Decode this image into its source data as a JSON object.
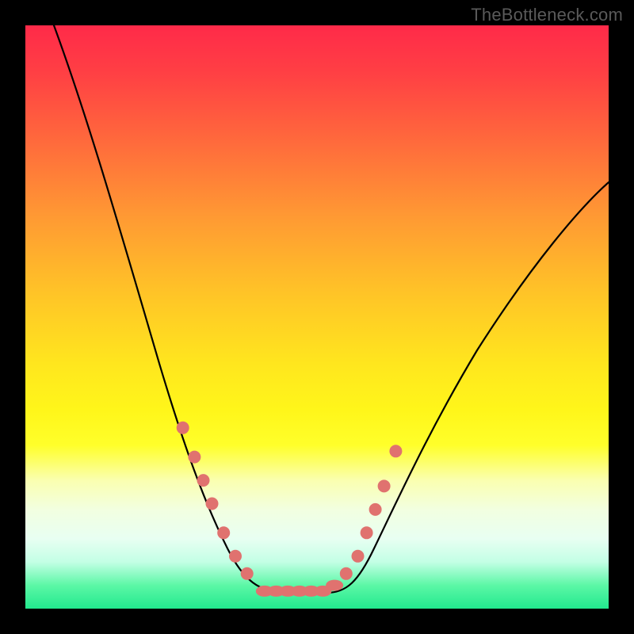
{
  "branding": {
    "watermark": "TheBottleneck.com"
  },
  "colors": {
    "frame": "#000000",
    "gradient_top": "#ff2a49",
    "gradient_bottom": "#22e98e",
    "curve_stroke": "#000000",
    "marker_fill": "#e0726f"
  },
  "chart_data": {
    "type": "line",
    "title": "",
    "xlabel": "",
    "ylabel": "",
    "xlim": [
      0,
      100
    ],
    "ylim": [
      0,
      100
    ],
    "note": "No axis ticks or numeric labels are rendered in the source image; x/y values are visual estimates on a 0–100 scale (0,0 at bottom-left of colored plot area). The curve is a V-shaped bottleneck profile with a flat minimum; marker dots sit along the curve near and at the minimum.",
    "series": [
      {
        "name": "bottleneck-curve",
        "x": [
          5,
          10,
          15,
          20,
          24,
          27,
          29,
          31,
          33,
          35,
          37,
          39,
          41,
          43,
          47,
          51,
          54,
          56,
          58,
          60,
          63,
          67,
          72,
          78,
          85,
          92,
          100
        ],
        "y": [
          100,
          85,
          68,
          52,
          40,
          31,
          25,
          20,
          16,
          12,
          9,
          6,
          4,
          3,
          3,
          3,
          4,
          6,
          9,
          13,
          19,
          27,
          36,
          44,
          51,
          57,
          62
        ]
      }
    ],
    "markers": {
      "name": "highlight-dots",
      "points": [
        {
          "x": 27,
          "y": 31
        },
        {
          "x": 29,
          "y": 26
        },
        {
          "x": 30.5,
          "y": 22
        },
        {
          "x": 32,
          "y": 18
        },
        {
          "x": 34,
          "y": 13
        },
        {
          "x": 36,
          "y": 9
        },
        {
          "x": 38,
          "y": 6
        },
        {
          "x": 41,
          "y": 3
        },
        {
          "x": 43,
          "y": 3
        },
        {
          "x": 45,
          "y": 3
        },
        {
          "x": 47,
          "y": 3
        },
        {
          "x": 49,
          "y": 3
        },
        {
          "x": 51,
          "y": 3
        },
        {
          "x": 53,
          "y": 4
        },
        {
          "x": 55,
          "y": 6
        },
        {
          "x": 57,
          "y": 9
        },
        {
          "x": 58.5,
          "y": 13
        },
        {
          "x": 60,
          "y": 17
        },
        {
          "x": 61.5,
          "y": 21
        },
        {
          "x": 63.5,
          "y": 27
        }
      ]
    }
  }
}
